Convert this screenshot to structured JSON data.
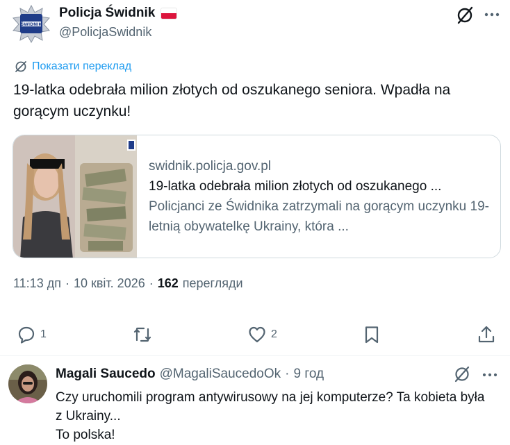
{
  "author": {
    "name": "Policja Świdnik",
    "handle": "@PolicjaSwidnik",
    "avatar_text": "ŚWIDNIK"
  },
  "translate_label": "Показати переклад",
  "tweet_text": "19-latka odebrała milion złotych od oszukanego seniora. Wpadła na gorącym uczynku!",
  "card": {
    "domain": "swidnik.policja.gov.pl",
    "title": "19-latka odebrała milion złotych od oszukanego ...",
    "description": "Policjanci ze Świdnika zatrzymali na gorącym uczynku 19-letnią obywatelkę Ukrainy, która ..."
  },
  "meta": {
    "time": "11:13 дп",
    "date": "10 квіт. 2026",
    "views_count": "162",
    "views_label": "перегляди"
  },
  "actions": {
    "reply_count": "1",
    "like_count": "2"
  },
  "reply": {
    "name": "Magali Saucedo",
    "handle": "@MagaliSaucedoOk",
    "time": "9 год",
    "text": "Czy uruchomili program antywirusowy na jej komputerze? Ta kobieta była z Ukrainy...\nTo polska!"
  },
  "colors": {
    "accent": "#1d9bf0",
    "text": "#0f1419",
    "secondary": "#536471",
    "border": "#cfd9de"
  }
}
